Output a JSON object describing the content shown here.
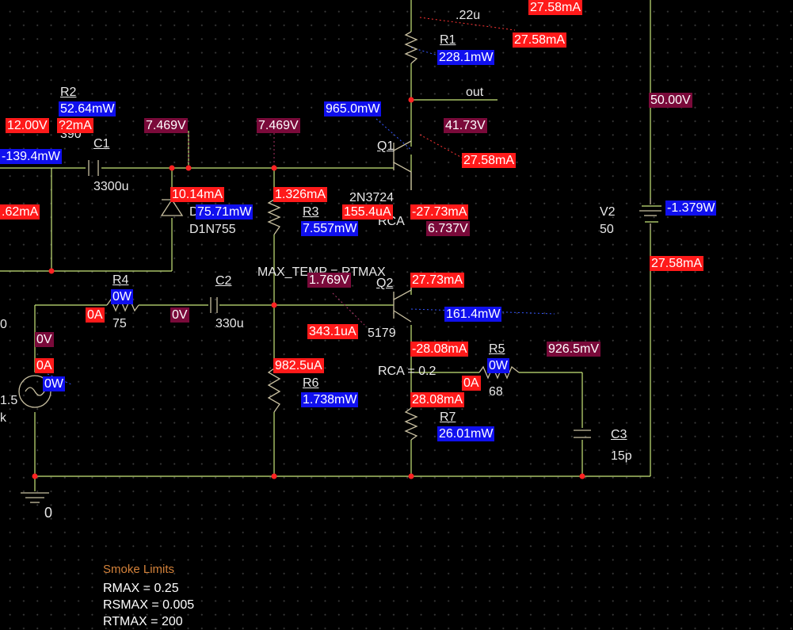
{
  "colors": {
    "background": "#000000",
    "wire": "#c8e67a",
    "part": "#c8bfa0",
    "junction": "#ff2222",
    "current_marker": "#ff1a1a",
    "power_marker": "#1010ee",
    "voltage_marker": "#7a0a3a",
    "smoke_title": "#d4823a"
  },
  "markers": {
    "current": [
      "27.58mA",
      "27.58mA",
      "27.58mA",
      "12.00V",
      ".62mA",
      "10.14mA",
      "1.326mA",
      "155.4uA",
      "-27.73mA",
      "27.73mA",
      "27.58mA",
      "0A",
      "343.1uA",
      "-28.08mA",
      "0A",
      "0A",
      "982.5uA",
      "28.08mA"
    ],
    "power": [
      "228.1mW",
      "52.64mW",
      "965.0mW",
      "-139.4mW",
      "75.71mW",
      "7.557mW",
      "-1.379W",
      "0W",
      "161.4mW",
      "0W",
      "0W",
      "1.738mW",
      "26.01mW"
    ],
    "voltage": [
      "50.00V",
      "7.469V",
      "7.469V",
      "41.73V",
      "6.737V",
      "1.769V",
      "0V",
      "0V",
      "926.5mV"
    ],
    "current_overlap": "?2mA"
  },
  "parts": {
    "r1": {
      "name": "R1",
      "value": ".22u"
    },
    "r2": {
      "name": "R2",
      "value": "390"
    },
    "c1": {
      "name": "C1",
      "value": "3300u"
    },
    "d1": {
      "name": "D",
      "model": "D1N755"
    },
    "r3": {
      "name": "R3"
    },
    "q1": {
      "name": "Q1",
      "model": "2N3724",
      "mfr": "RCA"
    },
    "v2": {
      "name": "V2",
      "value": "50"
    },
    "r4": {
      "name": "R4",
      "value": "75"
    },
    "c2": {
      "name": "C2",
      "value": "330u"
    },
    "q2": {
      "name": "Q2",
      "param": "MAX_TEMP = RTMAX",
      "model": "5179"
    },
    "r5": {
      "name": "R5",
      "value": "68"
    },
    "r6": {
      "name": "R6"
    },
    "r7": {
      "name": "R7"
    },
    "rca_param": "RCA = 0.2",
    "c3": {
      "name": "C3",
      "value": "15p"
    },
    "vsrc": {
      "value": "1.5",
      "extra": "k",
      "left_fragment": "0"
    },
    "ground": {
      "label": "0"
    }
  },
  "net_labels": {
    "out": "out"
  },
  "smoke_limits": {
    "title": "Smoke Limits",
    "lines": [
      "RMAX = 0.25",
      "RSMAX = 0.005",
      "RTMAX = 200"
    ]
  }
}
